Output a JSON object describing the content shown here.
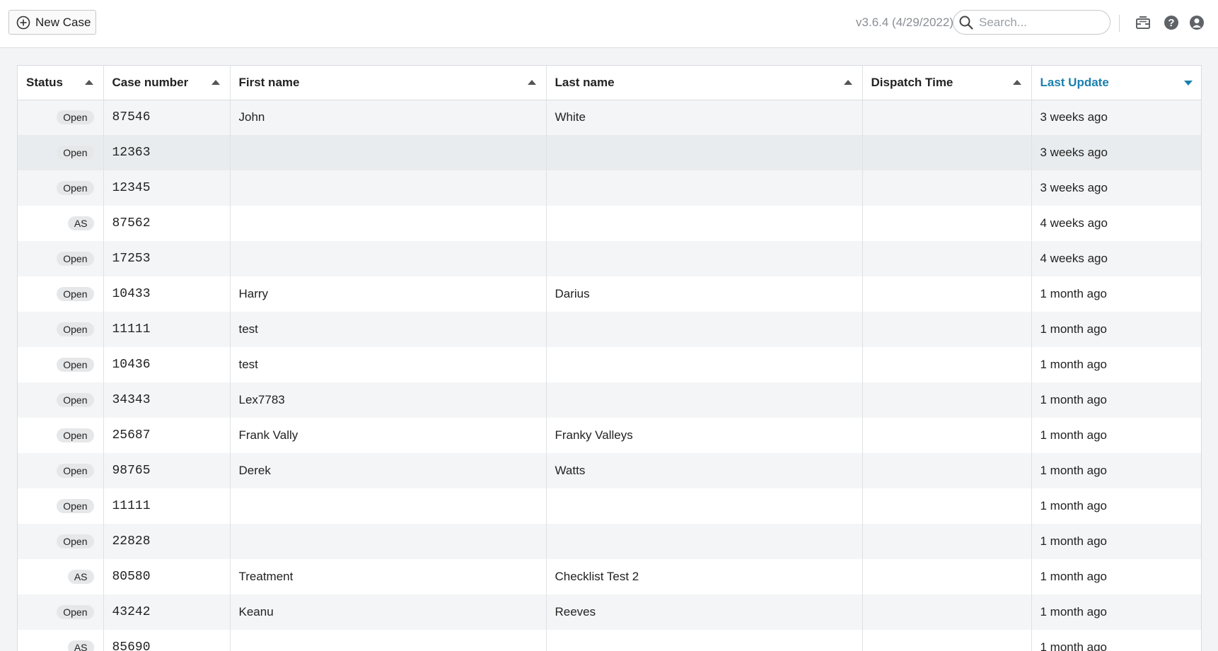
{
  "toolbar": {
    "new_case_label": "New Case",
    "version": "v3.6.4 (4/29/2022)",
    "search_placeholder": "Search..."
  },
  "colors": {
    "accent": "#1b7fae",
    "badge_bg": "#e6e7e8"
  },
  "icons": {
    "new_case": "plus-circle-icon",
    "search": "search-icon",
    "inbox": "inbox-icon",
    "help": "help-icon",
    "user": "user-icon"
  },
  "table": {
    "columns": [
      {
        "label": "Status",
        "sort": "asc"
      },
      {
        "label": "Case number",
        "sort": "asc"
      },
      {
        "label": "First name",
        "sort": "asc"
      },
      {
        "label": "Last name",
        "sort": "asc"
      },
      {
        "label": "Dispatch Time",
        "sort": "asc"
      },
      {
        "label": "Last Update",
        "sort": "desc"
      }
    ],
    "rows": [
      {
        "status": "Open",
        "case": "87546",
        "first": "John",
        "last": "White",
        "dispatch": "",
        "updated": "3 weeks ago"
      },
      {
        "status": "Open",
        "case": "12363",
        "first": "",
        "last": "",
        "dispatch": "",
        "updated": "3 weeks ago"
      },
      {
        "status": "Open",
        "case": "12345",
        "first": "",
        "last": "",
        "dispatch": "",
        "updated": "3 weeks ago"
      },
      {
        "status": "AS",
        "case": "87562",
        "first": "",
        "last": "",
        "dispatch": "",
        "updated": "4 weeks ago"
      },
      {
        "status": "Open",
        "case": "17253",
        "first": "",
        "last": "",
        "dispatch": "",
        "updated": "4 weeks ago"
      },
      {
        "status": "Open",
        "case": "10433",
        "first": "Harry",
        "last": "Darius",
        "dispatch": "",
        "updated": "1 month ago"
      },
      {
        "status": "Open",
        "case": "11111",
        "first": "test",
        "last": "",
        "dispatch": "",
        "updated": "1 month ago"
      },
      {
        "status": "Open",
        "case": "10436",
        "first": "test",
        "last": "",
        "dispatch": "",
        "updated": "1 month ago"
      },
      {
        "status": "Open",
        "case": "34343",
        "first": "Lex7783",
        "last": "",
        "dispatch": "",
        "updated": "1 month ago"
      },
      {
        "status": "Open",
        "case": "25687",
        "first": "Frank Vally",
        "last": "Franky Valleys",
        "dispatch": "",
        "updated": "1 month ago"
      },
      {
        "status": "Open",
        "case": "98765",
        "first": "Derek",
        "last": "Watts",
        "dispatch": "",
        "updated": "1 month ago"
      },
      {
        "status": "Open",
        "case": "11111",
        "first": "",
        "last": "",
        "dispatch": "",
        "updated": "1 month ago"
      },
      {
        "status": "Open",
        "case": "22828",
        "first": "",
        "last": "",
        "dispatch": "",
        "updated": "1 month ago"
      },
      {
        "status": "AS",
        "case": "80580",
        "first": "Treatment",
        "last": "Checklist Test 2",
        "dispatch": "",
        "updated": "1 month ago"
      },
      {
        "status": "Open",
        "case": "43242",
        "first": "Keanu",
        "last": "Reeves",
        "dispatch": "",
        "updated": "1 month ago"
      },
      {
        "status": "AS",
        "case": "85690",
        "first": "",
        "last": "",
        "dispatch": "",
        "updated": "1 month ago"
      }
    ]
  }
}
